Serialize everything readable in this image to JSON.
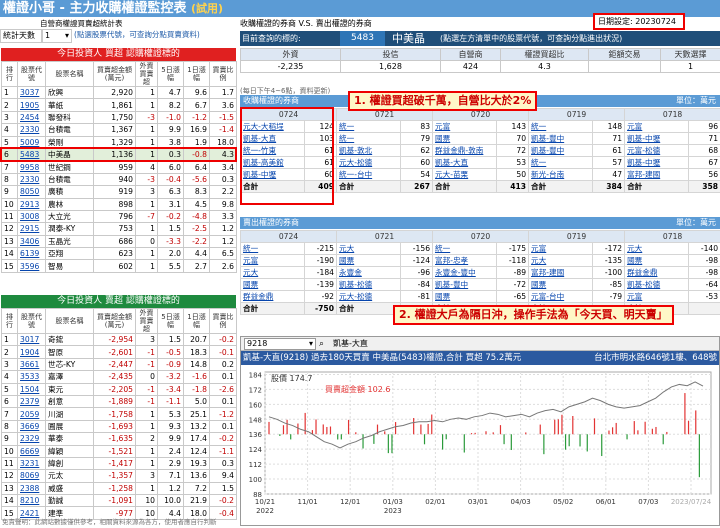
{
  "app": {
    "title": "權證小哥 - 主力收購權證監控表",
    "tag": "(試用)",
    "subtitle": "自營商權證買賣超統計表"
  },
  "stats": {
    "label": "統計天數",
    "value": "1",
    "hint": "(點選股票代號，可查詢分點買賣資料)"
  },
  "buy_table": {
    "title": "今日投資人 買超 認購權證標的",
    "headers": [
      "排行",
      "股票代號",
      "股票名稱",
      "買賣超金額(萬元)",
      "外資買賣超",
      "5日漲幅",
      "1日漲幅",
      "買賣比例"
    ],
    "rows": [
      [
        "1",
        "3037",
        "欣興",
        "2,920",
        "1",
        "4.7",
        "9.6",
        "1.7"
      ],
      [
        "2",
        "1905",
        "華紙",
        "1,861",
        "1",
        "8.2",
        "6.7",
        "3.6"
      ],
      [
        "3",
        "2454",
        "聯發科",
        "1,750",
        "-3",
        "-1.0",
        "-1.2",
        "-1.5"
      ],
      [
        "4",
        "2330",
        "台積電",
        "1,367",
        "1",
        "9.9",
        "16.9",
        "-1.4"
      ],
      [
        "5",
        "5009",
        "榮剛",
        "1,329",
        "1",
        "3.8",
        "1.9",
        "18.0"
      ],
      [
        "6",
        "5483",
        "中美晶",
        "1,136",
        "1",
        "0.3",
        "-0.8",
        "4.3"
      ],
      [
        "7",
        "9958",
        "世紀鋼",
        "959",
        "4",
        "6.0",
        "6.4",
        "3.4"
      ],
      [
        "8",
        "2330",
        "台積電",
        "940",
        "-3",
        "-0.4",
        "-5.6",
        "0.3"
      ],
      [
        "9",
        "8050",
        "廣積",
        "919",
        "3",
        "6.3",
        "8.3",
        "2.2"
      ],
      [
        "10",
        "2913",
        "農林",
        "898",
        "1",
        "3.1",
        "4.5",
        "9.8"
      ],
      [
        "11",
        "3008",
        "大立光",
        "796",
        "-7",
        "-0.2",
        "-4.8",
        "3.3"
      ],
      [
        "12",
        "2915",
        "潤泰-KY",
        "753",
        "1",
        "1.5",
        "-2.5",
        "1.2"
      ],
      [
        "13",
        "3406",
        "玉晶光",
        "686",
        "0",
        "-3.3",
        "-2.2",
        "1.2"
      ],
      [
        "14",
        "6139",
        "亞翔",
        "623",
        "1",
        "2.0",
        "4.4",
        "6.5"
      ],
      [
        "15",
        "3596",
        "智易",
        "602",
        "1",
        "5.5",
        "2.7",
        "2.6"
      ]
    ]
  },
  "sell_table": {
    "title": "今日投資人 賣超 認購權證標的",
    "headers": [
      "排行",
      "股票代號",
      "股票名稱",
      "買賣超金額(萬元)",
      "外資買賣超",
      "5日漲幅",
      "1日漲幅",
      "買賣比例"
    ],
    "rows": [
      [
        "1",
        "3017",
        "奇鋐",
        "-2,954",
        "3",
        "1.5",
        "20.7",
        "-0.2"
      ],
      [
        "2",
        "1904",
        "智原",
        "-2,601",
        "-1",
        "-0.5",
        "18.3",
        "-0.1"
      ],
      [
        "3",
        "3661",
        "世芯-KY",
        "-2,447",
        "-1",
        "-0.9",
        "14.8",
        "0.2"
      ],
      [
        "4",
        "3533",
        "嘉澤",
        "-2,435",
        "0",
        "-3.2",
        "-1.6",
        "0.1"
      ],
      [
        "5",
        "1504",
        "東元",
        "-2,205",
        "-1",
        "-3.4",
        "-1.8",
        "-2.6"
      ],
      [
        "6",
        "2379",
        "創意",
        "-1,889",
        "-1",
        "-1.1",
        "5.0",
        "0.1"
      ],
      [
        "7",
        "2059",
        "川湖",
        "-1,758",
        "1",
        "5.3",
        "25.1",
        "-1.2"
      ],
      [
        "8",
        "3669",
        "圓展",
        "-1,693",
        "1",
        "9.3",
        "13.2",
        "0.1"
      ],
      [
        "9",
        "2329",
        "華泰",
        "-1,635",
        "2",
        "9.9",
        "17.4",
        "-0.2"
      ],
      [
        "10",
        "6669",
        "緯穎",
        "-1,521",
        "1",
        "2.4",
        "12.4",
        "-1.1"
      ],
      [
        "11",
        "3231",
        "緯創",
        "-1,417",
        "1",
        "2.9",
        "19.3",
        "0.3"
      ],
      [
        "12",
        "8069",
        "元太",
        "-1,357",
        "3",
        "7.1",
        "13.6",
        "9.4"
      ],
      [
        "13",
        "2388",
        "威盛",
        "-1,258",
        "1",
        "1.2",
        "7.2",
        "1.5"
      ],
      [
        "14",
        "8210",
        "勤誠",
        "-1,091",
        "10",
        "10.0",
        "21.9",
        "-0.2"
      ],
      [
        "15",
        "2421",
        "建準",
        "-977",
        "10",
        "4.4",
        "18.0",
        "-0.4"
      ]
    ]
  },
  "right": {
    "title": "收購權證的券商 V.S. 賣出權證的券商",
    "date_label": "日期設定:",
    "date_value": "20230724",
    "query_label": "目前查詢的標的:",
    "query_code": "5483",
    "query_name": "中美晶",
    "query_hint": "(點選左方清單中的股票代號，可查詢分點進出狀況)",
    "summary_headers": [
      "外資",
      "投信",
      "自營商",
      "權證買超比",
      "鉅額交易",
      "天數選擇"
    ],
    "summary_values": [
      "-2,235",
      "1,628",
      "424",
      "4.3",
      "",
      "1"
    ],
    "note": "(每日下午4~6點，資料更新)"
  },
  "buy_section": {
    "title": "收購權證的券商",
    "unit": "單位：萬元",
    "total_label": "合計",
    "dates": [
      "0724",
      "0721",
      "0720",
      "0719",
      "0718"
    ],
    "cols": [
      {
        "rows": [
          [
            "元大-大稻埕",
            "124"
          ],
          [
            "凱基-大直",
            "103"
          ],
          [
            "統一-竹東",
            "61"
          ],
          [
            "凱基-高美館",
            "61"
          ],
          [
            "凱基-中壢",
            "60"
          ]
        ],
        "total": "409"
      },
      {
        "rows": [
          [
            "統一",
            "83"
          ],
          [
            "統一",
            "79"
          ],
          [
            "凱基-敦北",
            "62"
          ],
          [
            "元大-松德",
            "60"
          ],
          [
            "統一-台中",
            "54"
          ]
        ],
        "total": "267"
      },
      {
        "rows": [
          [
            "元富",
            "143"
          ],
          [
            "國票",
            "70"
          ],
          [
            "群益金鼎-敦南",
            "72"
          ],
          [
            "凱基-大直",
            "53"
          ],
          [
            "元大-苗栗",
            "50"
          ]
        ],
        "total": "413"
      },
      {
        "rows": [
          [
            "統一",
            "148"
          ],
          [
            "凱基-豐中",
            "71"
          ],
          [
            "凱基-豐中",
            "61"
          ],
          [
            "統一",
            "57"
          ],
          [
            "新光-台南",
            "47"
          ]
        ],
        "total": "384"
      },
      {
        "rows": [
          [
            "元富",
            "96"
          ],
          [
            "凱基-中壢",
            "71"
          ],
          [
            "元富-松德",
            "68"
          ],
          [
            "凱基-中壢",
            "67"
          ],
          [
            "富邦-建國",
            "56"
          ]
        ],
        "total": "358"
      }
    ]
  },
  "sell_section": {
    "title": "賣出權證的券商",
    "unit": "單位：萬元",
    "total_label": "合計",
    "dates": [
      "0724",
      "0721",
      "0720",
      "0719",
      "0718"
    ],
    "cols": [
      {
        "rows": [
          [
            "統一",
            "-215"
          ],
          [
            "元富",
            "-190"
          ],
          [
            "元大",
            "-184"
          ],
          [
            "國票",
            "-139"
          ],
          [
            "群益金鼎",
            "-92"
          ]
        ],
        "total": "-750"
      },
      {
        "rows": [
          [
            "元大",
            "-156"
          ],
          [
            "國票",
            "-124"
          ],
          [
            "永豐金",
            "-96"
          ],
          [
            "凱基-松德",
            "-84"
          ],
          [
            "元大-松德",
            "-81"
          ]
        ],
        "total": ""
      },
      {
        "rows": [
          [
            "統一",
            "-175"
          ],
          [
            "富邦-忠孝",
            "-118"
          ],
          [
            "永豐金-豐中",
            "-89"
          ],
          [
            "凱基-豐中",
            "-72"
          ],
          [
            "國票",
            "-65"
          ]
        ],
        "total": ""
      },
      {
        "rows": [
          [
            "元富",
            "-172"
          ],
          [
            "元大",
            "-135"
          ],
          [
            "富邦-建國",
            "-100"
          ],
          [
            "國票",
            "-85"
          ],
          [
            "元富-台中",
            "-79"
          ]
        ],
        "total": ""
      },
      {
        "rows": [
          [
            "元大",
            "-140"
          ],
          [
            "國票",
            "-98"
          ],
          [
            "群益金鼎",
            "-98"
          ],
          [
            "凱基-松德",
            "-64"
          ],
          [
            "元富",
            "-53"
          ]
        ],
        "total": ""
      }
    ]
  },
  "callouts": {
    "one": "1. 權證買超破千萬，自營比大於2%",
    "two": "2. 權證大戶為隔日沖，操作手法為「今天買、明天賣」"
  },
  "chart": {
    "toolbar_code": "9218",
    "toolbar_name": "凱基-大直",
    "header": "凱基-大直(9218) 過去180天買賣 中美晶(5483)權證,合計  買超 75.2萬元",
    "header_addr": "台北市明水路646號1樓、648號",
    "legend_price": "股價 174.7",
    "legend_amount": "買賣超金額 102.6",
    "chart_data": {
      "type": "bar+line",
      "x_ticks": [
        "10/21",
        "11/01",
        "12/01",
        "01/03",
        "02/01",
        "03/01",
        "04/03",
        "05/02",
        "06/01",
        "07/03",
        "2023/07/24"
      ],
      "x_years": [
        "2022",
        "",
        "",
        "2023"
      ],
      "y_ticks": [
        184,
        172,
        160,
        148,
        136,
        124,
        112,
        100,
        88
      ],
      "ylim": [
        88,
        186
      ],
      "price": [
        150,
        148,
        145,
        143,
        140,
        138,
        134,
        130,
        128,
        125,
        128,
        130,
        133,
        135,
        138,
        140,
        142,
        143,
        145,
        146,
        146,
        147,
        146,
        148,
        149,
        148,
        150,
        151,
        153,
        152,
        150,
        151,
        152,
        150,
        153,
        155,
        156,
        154,
        158,
        160,
        162,
        165,
        163,
        160,
        158,
        157,
        158,
        159,
        162,
        165,
        170,
        174,
        176,
        175,
        178,
        174.7
      ],
      "price_color": "#777777",
      "amount_color": "#e33333"
    }
  },
  "disclaimer": "免責聲明：此網站數據僅供參考，相關資料來源為各方，使用者應自行判斷"
}
